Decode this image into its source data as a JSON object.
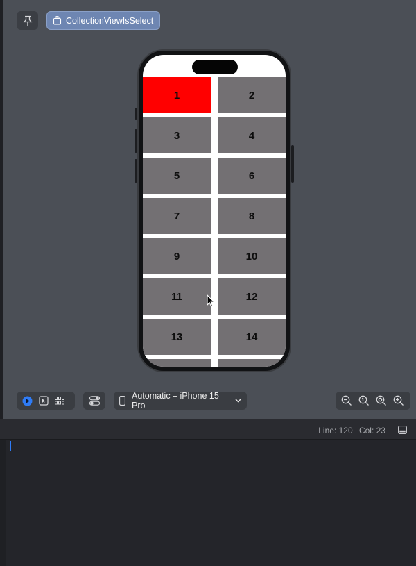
{
  "canvas": {
    "preview_name": "CollectionViewIsSelect"
  },
  "collection": {
    "cells": [
      "1",
      "2",
      "3",
      "4",
      "5",
      "6",
      "7",
      "8",
      "9",
      "10",
      "11",
      "12",
      "13",
      "14"
    ],
    "selected_index": 0,
    "selected_color": "#ff0000",
    "cell_color": "#737073"
  },
  "toolbar": {
    "device_label": "Automatic – iPhone 15 Pro",
    "live_icon": "play-circle-icon",
    "select_icon": "cursor-select-icon",
    "variants_icon": "grid-icon",
    "settings_icon": "toggle-settings-icon",
    "zoom_icons": [
      "zoom-out-icon",
      "zoom-100-icon",
      "zoom-fit-icon",
      "zoom-in-icon"
    ]
  },
  "statusbar": {
    "line_label": "Line: 120",
    "col_label": "Col: 23"
  },
  "colors": {
    "accent": "#2f7cf6",
    "chip": "#6e86b2"
  }
}
